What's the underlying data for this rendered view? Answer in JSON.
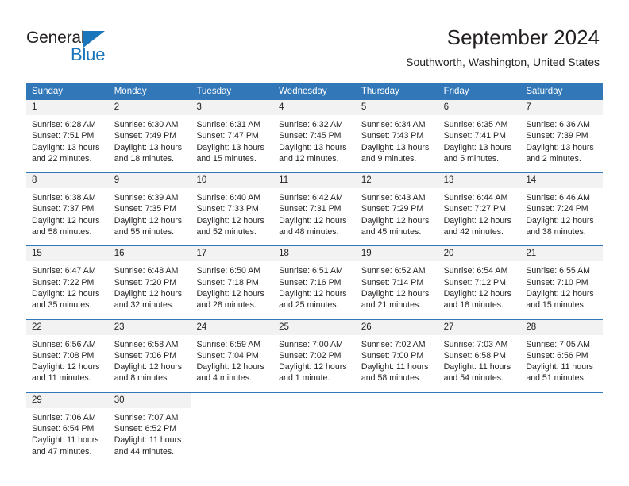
{
  "brand": {
    "name_top": "General",
    "name_bottom": "Blue",
    "accent_color": "#1b75bb"
  },
  "header": {
    "title": "September 2024",
    "subtitle": "Southworth, Washington, United States"
  },
  "theme": {
    "header_blue": "#3278b8",
    "day_band_gray": "#f2f2f2",
    "text_color": "#231f20"
  },
  "weekdays": [
    "Sunday",
    "Monday",
    "Tuesday",
    "Wednesday",
    "Thursday",
    "Friday",
    "Saturday"
  ],
  "weeks": [
    [
      {
        "day": "1",
        "sunrise": "Sunrise: 6:28 AM",
        "sunset": "Sunset: 7:51 PM",
        "daylight1": "Daylight: 13 hours",
        "daylight2": "and 22 minutes."
      },
      {
        "day": "2",
        "sunrise": "Sunrise: 6:30 AM",
        "sunset": "Sunset: 7:49 PM",
        "daylight1": "Daylight: 13 hours",
        "daylight2": "and 18 minutes."
      },
      {
        "day": "3",
        "sunrise": "Sunrise: 6:31 AM",
        "sunset": "Sunset: 7:47 PM",
        "daylight1": "Daylight: 13 hours",
        "daylight2": "and 15 minutes."
      },
      {
        "day": "4",
        "sunrise": "Sunrise: 6:32 AM",
        "sunset": "Sunset: 7:45 PM",
        "daylight1": "Daylight: 13 hours",
        "daylight2": "and 12 minutes."
      },
      {
        "day": "5",
        "sunrise": "Sunrise: 6:34 AM",
        "sunset": "Sunset: 7:43 PM",
        "daylight1": "Daylight: 13 hours",
        "daylight2": "and 9 minutes."
      },
      {
        "day": "6",
        "sunrise": "Sunrise: 6:35 AM",
        "sunset": "Sunset: 7:41 PM",
        "daylight1": "Daylight: 13 hours",
        "daylight2": "and 5 minutes."
      },
      {
        "day": "7",
        "sunrise": "Sunrise: 6:36 AM",
        "sunset": "Sunset: 7:39 PM",
        "daylight1": "Daylight: 13 hours",
        "daylight2": "and 2 minutes."
      }
    ],
    [
      {
        "day": "8",
        "sunrise": "Sunrise: 6:38 AM",
        "sunset": "Sunset: 7:37 PM",
        "daylight1": "Daylight: 12 hours",
        "daylight2": "and 58 minutes."
      },
      {
        "day": "9",
        "sunrise": "Sunrise: 6:39 AM",
        "sunset": "Sunset: 7:35 PM",
        "daylight1": "Daylight: 12 hours",
        "daylight2": "and 55 minutes."
      },
      {
        "day": "10",
        "sunrise": "Sunrise: 6:40 AM",
        "sunset": "Sunset: 7:33 PM",
        "daylight1": "Daylight: 12 hours",
        "daylight2": "and 52 minutes."
      },
      {
        "day": "11",
        "sunrise": "Sunrise: 6:42 AM",
        "sunset": "Sunset: 7:31 PM",
        "daylight1": "Daylight: 12 hours",
        "daylight2": "and 48 minutes."
      },
      {
        "day": "12",
        "sunrise": "Sunrise: 6:43 AM",
        "sunset": "Sunset: 7:29 PM",
        "daylight1": "Daylight: 12 hours",
        "daylight2": "and 45 minutes."
      },
      {
        "day": "13",
        "sunrise": "Sunrise: 6:44 AM",
        "sunset": "Sunset: 7:27 PM",
        "daylight1": "Daylight: 12 hours",
        "daylight2": "and 42 minutes."
      },
      {
        "day": "14",
        "sunrise": "Sunrise: 6:46 AM",
        "sunset": "Sunset: 7:24 PM",
        "daylight1": "Daylight: 12 hours",
        "daylight2": "and 38 minutes."
      }
    ],
    [
      {
        "day": "15",
        "sunrise": "Sunrise: 6:47 AM",
        "sunset": "Sunset: 7:22 PM",
        "daylight1": "Daylight: 12 hours",
        "daylight2": "and 35 minutes."
      },
      {
        "day": "16",
        "sunrise": "Sunrise: 6:48 AM",
        "sunset": "Sunset: 7:20 PM",
        "daylight1": "Daylight: 12 hours",
        "daylight2": "and 32 minutes."
      },
      {
        "day": "17",
        "sunrise": "Sunrise: 6:50 AM",
        "sunset": "Sunset: 7:18 PM",
        "daylight1": "Daylight: 12 hours",
        "daylight2": "and 28 minutes."
      },
      {
        "day": "18",
        "sunrise": "Sunrise: 6:51 AM",
        "sunset": "Sunset: 7:16 PM",
        "daylight1": "Daylight: 12 hours",
        "daylight2": "and 25 minutes."
      },
      {
        "day": "19",
        "sunrise": "Sunrise: 6:52 AM",
        "sunset": "Sunset: 7:14 PM",
        "daylight1": "Daylight: 12 hours",
        "daylight2": "and 21 minutes."
      },
      {
        "day": "20",
        "sunrise": "Sunrise: 6:54 AM",
        "sunset": "Sunset: 7:12 PM",
        "daylight1": "Daylight: 12 hours",
        "daylight2": "and 18 minutes."
      },
      {
        "day": "21",
        "sunrise": "Sunrise: 6:55 AM",
        "sunset": "Sunset: 7:10 PM",
        "daylight1": "Daylight: 12 hours",
        "daylight2": "and 15 minutes."
      }
    ],
    [
      {
        "day": "22",
        "sunrise": "Sunrise: 6:56 AM",
        "sunset": "Sunset: 7:08 PM",
        "daylight1": "Daylight: 12 hours",
        "daylight2": "and 11 minutes."
      },
      {
        "day": "23",
        "sunrise": "Sunrise: 6:58 AM",
        "sunset": "Sunset: 7:06 PM",
        "daylight1": "Daylight: 12 hours",
        "daylight2": "and 8 minutes."
      },
      {
        "day": "24",
        "sunrise": "Sunrise: 6:59 AM",
        "sunset": "Sunset: 7:04 PM",
        "daylight1": "Daylight: 12 hours",
        "daylight2": "and 4 minutes."
      },
      {
        "day": "25",
        "sunrise": "Sunrise: 7:00 AM",
        "sunset": "Sunset: 7:02 PM",
        "daylight1": "Daylight: 12 hours",
        "daylight2": "and 1 minute."
      },
      {
        "day": "26",
        "sunrise": "Sunrise: 7:02 AM",
        "sunset": "Sunset: 7:00 PM",
        "daylight1": "Daylight: 11 hours",
        "daylight2": "and 58 minutes."
      },
      {
        "day": "27",
        "sunrise": "Sunrise: 7:03 AM",
        "sunset": "Sunset: 6:58 PM",
        "daylight1": "Daylight: 11 hours",
        "daylight2": "and 54 minutes."
      },
      {
        "day": "28",
        "sunrise": "Sunrise: 7:05 AM",
        "sunset": "Sunset: 6:56 PM",
        "daylight1": "Daylight: 11 hours",
        "daylight2": "and 51 minutes."
      }
    ],
    [
      {
        "day": "29",
        "sunrise": "Sunrise: 7:06 AM",
        "sunset": "Sunset: 6:54 PM",
        "daylight1": "Daylight: 11 hours",
        "daylight2": "and 47 minutes."
      },
      {
        "day": "30",
        "sunrise": "Sunrise: 7:07 AM",
        "sunset": "Sunset: 6:52 PM",
        "daylight1": "Daylight: 11 hours",
        "daylight2": "and 44 minutes."
      },
      {
        "day": "",
        "sunrise": "",
        "sunset": "",
        "daylight1": "",
        "daylight2": ""
      },
      {
        "day": "",
        "sunrise": "",
        "sunset": "",
        "daylight1": "",
        "daylight2": ""
      },
      {
        "day": "",
        "sunrise": "",
        "sunset": "",
        "daylight1": "",
        "daylight2": ""
      },
      {
        "day": "",
        "sunrise": "",
        "sunset": "",
        "daylight1": "",
        "daylight2": ""
      },
      {
        "day": "",
        "sunrise": "",
        "sunset": "",
        "daylight1": "",
        "daylight2": ""
      }
    ]
  ]
}
